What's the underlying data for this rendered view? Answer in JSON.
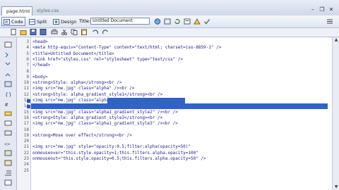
{
  "tabs": [
    {
      "label": "page.html",
      "active": true
    },
    {
      "label": "styles.css",
      "active": false
    }
  ],
  "window_controls": [
    "–",
    "❐",
    "✕"
  ],
  "toolbar": {
    "views": [
      {
        "label": "Code",
        "pressed": true
      },
      {
        "label": "Split",
        "pressed": false
      },
      {
        "label": "Design",
        "pressed": false
      }
    ],
    "title_label": "Title:",
    "title_value": "Untitled Document"
  },
  "code": {
    "line_numbers": [
      "3",
      "4",
      "5",
      "6",
      "7",
      "8",
      "9",
      "10",
      "11",
      "12",
      "13",
      "14",
      "15",
      "16",
      "17",
      "18",
      "19",
      "20",
      "21",
      "22",
      "23",
      "24",
      "25"
    ],
    "lines": [
      "<head>",
      "<meta http-equiv=\"Content-Type\" content=\"text/html; charset=iso-8859-1\" />",
      "<title>Untitled Document</title>",
      "<link href=\"styles.css\" rel=\"stylesheet\" type=\"text/css\" />",
      "</head>",
      "",
      "<body>",
      "<strong>Style: alpha</strong><br />",
      "<img src=\"me.jpg\" class=\"alpha\" /><br />",
      "<strong>Style: alpha_gradient_style1</strong><br />",
      "<img src=\"me.jpg\" class=\"alpha1_gradient_style1\" /><br />",
      "<strong>Style: alpha_gradient_style2</strong><br />",
      "<img src=\"me.jpg\" class=\"alpha1_gradient_style2\" /><br />",
      "<strong>Style: alpha_gradient_style3</strong><br />",
      "<img src=\"me.jpg\" class=\"alpha1_gradient_style3\" /><br />",
      "",
      "<strong>Mose over effect</strong><br />",
      "",
      "<img src=\"me.jpg\" style=\"opacity:0.5;filter:alpha(opacity=50)\"",
      "onmouseover=\"this.style.opacity=1;this.filters.alpha.opacity=100\"",
      "onmouseout=\"this.style.opacity=0.5;this.filters.alpha.opacity=50\" />",
      "",
      ""
    ],
    "selection_line_index": 10,
    "selection_full_line_index": 11
  },
  "colors": {
    "selection": "#3163c6",
    "code_text": "#1a1a8c"
  }
}
